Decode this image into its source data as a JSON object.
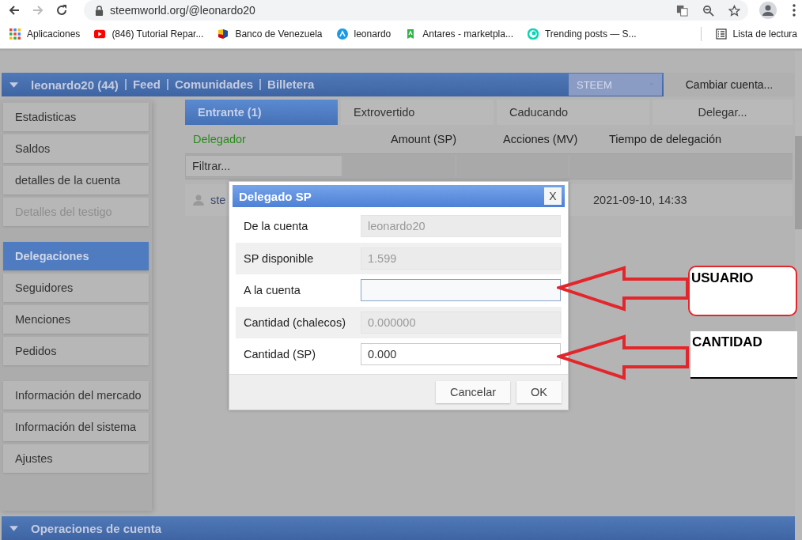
{
  "browser": {
    "url": "steemworld.org/@leonardo20",
    "bookmarks": [
      {
        "label": "Aplicaciones",
        "kind": "apps"
      },
      {
        "label": "(846) Tutorial Repar...",
        "kind": "video"
      },
      {
        "label": "Banco de Venezuela",
        "kind": "flag"
      },
      {
        "label": "leonardo",
        "kind": "circle"
      },
      {
        "label": "Antares - marketpla...",
        "kind": "badge"
      },
      {
        "label": "Trending posts — S...",
        "kind": "swirl"
      }
    ],
    "reading_list": "Lista de lectura"
  },
  "top_bar": {
    "nav": [
      "leonardo20 (44)",
      "Feed",
      "Comunidades",
      "Billetera"
    ],
    "currency": "STEEM",
    "switch_button": "Cambiar cuenta..."
  },
  "sidebar": {
    "groups": [
      [
        {
          "label": "Estadisticas",
          "selected": false,
          "disabled": false
        },
        {
          "label": "Saldos",
          "selected": false,
          "disabled": false
        },
        {
          "label": "detalles de la cuenta",
          "selected": false,
          "disabled": false
        },
        {
          "label": "Detalles del testigo",
          "selected": false,
          "disabled": true
        }
      ],
      [
        {
          "label": "Delegaciones",
          "selected": true,
          "disabled": false
        },
        {
          "label": "Seguidores",
          "selected": false,
          "disabled": false
        },
        {
          "label": "Menciones",
          "selected": false,
          "disabled": false
        },
        {
          "label": "Pedidos",
          "selected": false,
          "disabled": false
        }
      ],
      [
        {
          "label": "Información del mercado",
          "selected": false,
          "disabled": false
        },
        {
          "label": "Información del sistema",
          "selected": false,
          "disabled": false
        },
        {
          "label": "Ajustes",
          "selected": false,
          "disabled": false
        }
      ]
    ]
  },
  "tabs": [
    {
      "label": "Entrante (1)",
      "selected": true
    },
    {
      "label": "Extrovertido",
      "selected": false
    },
    {
      "label": "Caducando",
      "selected": false
    },
    {
      "label": "Delegar...",
      "selected": false
    }
  ],
  "table": {
    "columns": [
      {
        "label": "Delegador",
        "sorted": true
      },
      {
        "label": "Amount (SP)",
        "sorted": false
      },
      {
        "label": "Acciones (MV)",
        "sorted": false
      },
      {
        "label": "Tiempo de delegación",
        "sorted": false
      }
    ],
    "filter_placeholder": "Filtrar...",
    "rows": [
      {
        "delegator": "ste",
        "time": "2021-09-10, 14:33"
      }
    ]
  },
  "dialog": {
    "title": "Delegado SP",
    "close": "X",
    "fields": [
      {
        "label": "De la cuenta",
        "value": "leonardo20",
        "disabled": true,
        "focused": false
      },
      {
        "label": "SP disponible",
        "value": "1.599",
        "disabled": true,
        "focused": false
      },
      {
        "label": "A la cuenta",
        "disabled": false,
        "focused": true
      },
      {
        "label": "Cantidad (chalecos)",
        "value": "0.000000",
        "disabled": true,
        "focused": false
      },
      {
        "label": "Cantidad (SP)",
        "value": "0.000",
        "disabled": false,
        "focused": false
      }
    ],
    "buttons": [
      "Cancelar",
      "OK"
    ]
  },
  "annotations": [
    {
      "label": "USUARIO"
    },
    {
      "label": "CANTIDAD"
    }
  ],
  "bottom_section": "Operaciones de cuenta"
}
